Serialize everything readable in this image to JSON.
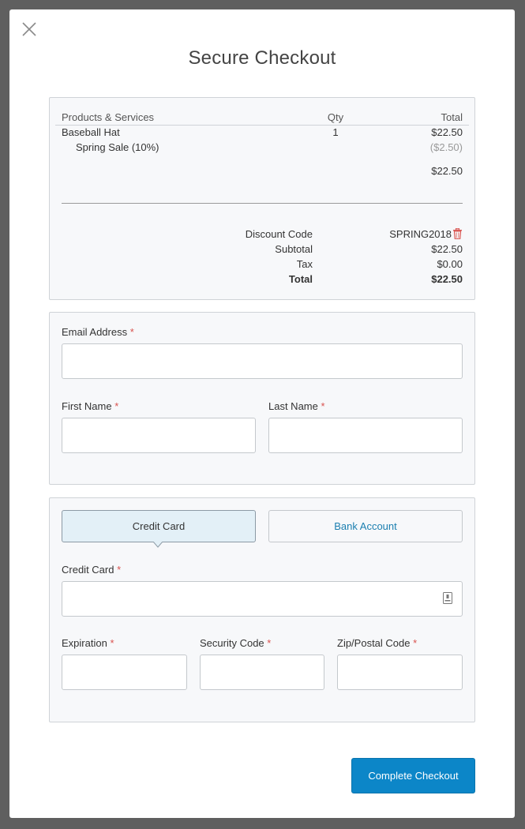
{
  "modal": {
    "title": "Secure Checkout"
  },
  "summary": {
    "headers": {
      "product": "Products & Services",
      "qty": "Qty",
      "total": "Total"
    },
    "items": [
      {
        "name": "Baseball Hat",
        "qty": "1",
        "total": "$22.50"
      }
    ],
    "discount_line": {
      "name": "Spring Sale (10%)",
      "amount": "($2.50)"
    },
    "item_subtotal": "$22.50",
    "totals": {
      "discount_code_label": "Discount Code",
      "discount_code_value": "SPRING2018",
      "subtotal_label": "Subtotal",
      "subtotal_value": "$22.50",
      "tax_label": "Tax",
      "tax_value": "$0.00",
      "total_label": "Total",
      "total_value": "$22.50"
    }
  },
  "contact": {
    "email_label": "Email Address",
    "email_value": "",
    "first_name_label": "First Name",
    "first_name_value": "",
    "last_name_label": "Last Name",
    "last_name_value": "",
    "required_mark": "*"
  },
  "payment": {
    "tabs": [
      {
        "label": "Credit Card",
        "active": true
      },
      {
        "label": "Bank Account",
        "active": false
      }
    ],
    "card_label": "Credit Card",
    "card_value": "",
    "expiration_label": "Expiration",
    "expiration_value": "",
    "security_label": "Security Code",
    "security_value": "",
    "zip_label": "Zip/Postal Code",
    "zip_value": ""
  },
  "actions": {
    "complete_label": "Complete Checkout"
  },
  "colors": {
    "accent": "#0c86c8",
    "required": "#d9534f",
    "trash": "#d9534f",
    "active_tab_bg": "#e3f0f7"
  },
  "icons": {
    "close": "close-icon",
    "trash": "trash-icon",
    "card_field": "card-reader-icon",
    "tab_caret": "caret-down-icon"
  }
}
